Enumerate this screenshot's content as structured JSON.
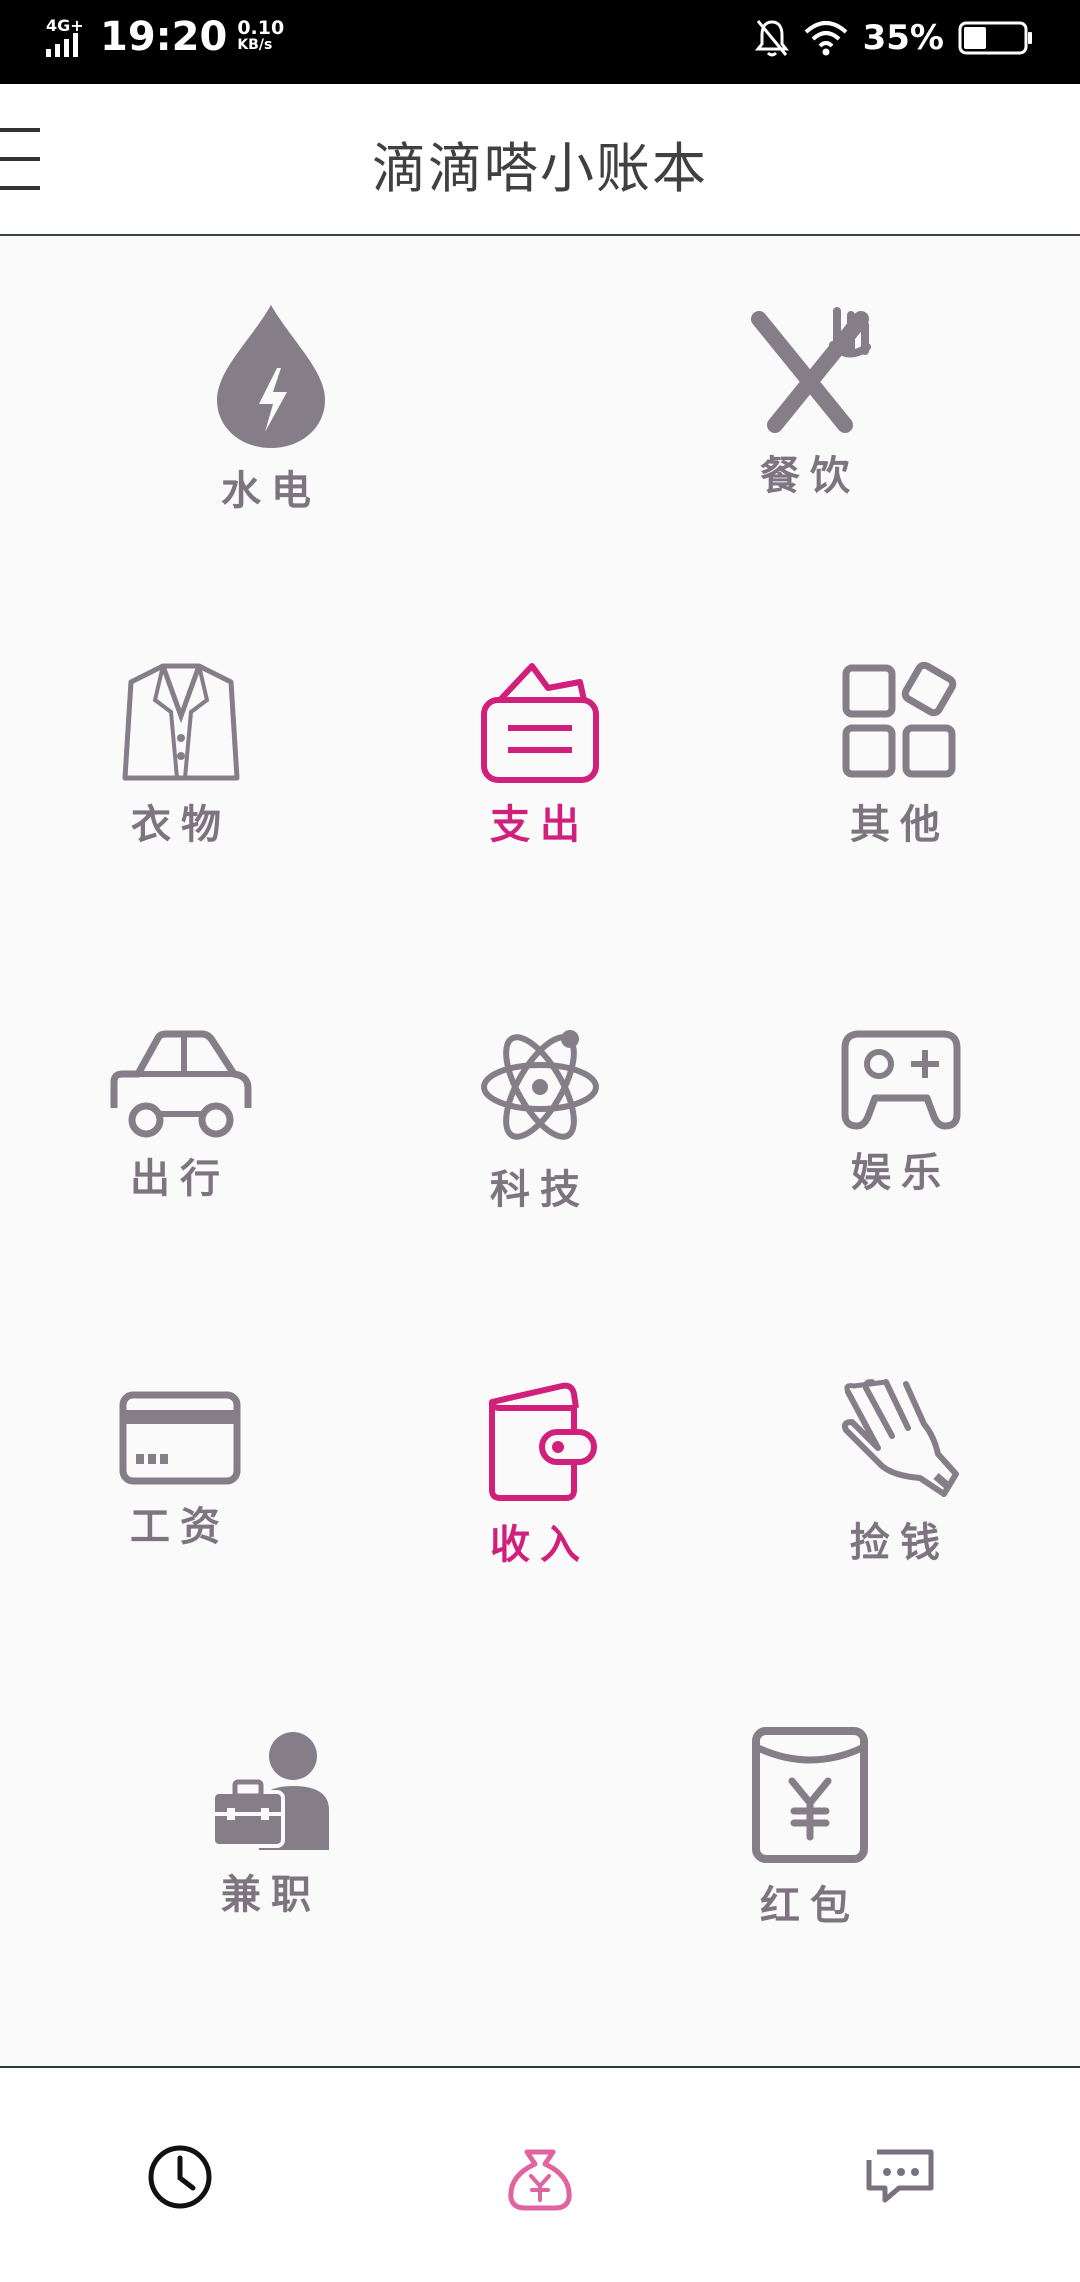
{
  "status_bar": {
    "network": "4G+",
    "time": "19:20",
    "speed_value": "0.10",
    "speed_unit": "KB/s",
    "battery": "35%"
  },
  "header": {
    "title": "滴滴嗒小账本"
  },
  "categories": [
    {
      "label": "水电",
      "icon": "water-electricity-icon"
    },
    {
      "label": "餐饮",
      "icon": "fork-knife-icon"
    },
    {
      "label": "衣物",
      "icon": "jacket-icon"
    },
    {
      "label": "支出",
      "icon": "expense-card-icon"
    },
    {
      "label": "其他",
      "icon": "other-grid-icon"
    },
    {
      "label": "出行",
      "icon": "car-icon"
    },
    {
      "label": "科技",
      "icon": "atom-icon"
    },
    {
      "label": "娱乐",
      "icon": "gamepad-icon"
    },
    {
      "label": "工资",
      "icon": "credit-card-icon"
    },
    {
      "label": "收入",
      "icon": "wallet-icon"
    },
    {
      "label": "捡钱",
      "icon": "hand-icon"
    },
    {
      "label": "兼职",
      "icon": "briefcase-person-icon"
    },
    {
      "label": "红包",
      "icon": "red-envelope-icon"
    }
  ],
  "colors": {
    "accent": "#d11f7c",
    "icon_gray": "#857d88",
    "header_text": "#404040"
  },
  "bottom_nav": [
    "clock-icon",
    "money-bag-icon",
    "chat-icon"
  ]
}
